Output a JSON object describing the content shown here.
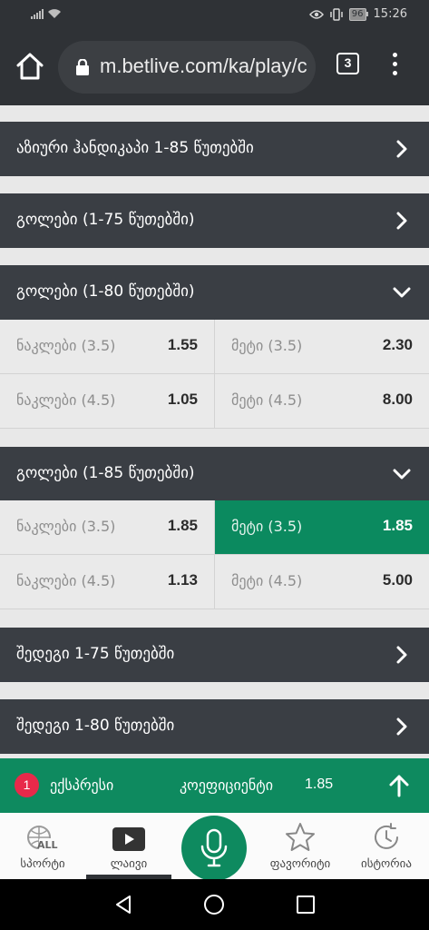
{
  "status": {
    "time": "15:26",
    "battery": "96"
  },
  "browser": {
    "url": "m.betlive.com/ka/play/c",
    "tab_count": "3"
  },
  "sections": [
    {
      "title": "აზიური ჰანდიკაპი 1-85 წუთებში",
      "expanded": false
    },
    {
      "title": "გოლები (1-75 წუთებში)",
      "expanded": false
    },
    {
      "title": "გოლები (1-80 წუთებში)",
      "expanded": true,
      "rows": [
        {
          "under_label": "ნაკლები (3.5)",
          "under_odd": "1.55",
          "over_label": "მეტი (3.5)",
          "over_odd": "2.30"
        },
        {
          "under_label": "ნაკლები (4.5)",
          "under_odd": "1.05",
          "over_label": "მეტი (4.5)",
          "over_odd": "8.00"
        }
      ]
    },
    {
      "title": "გოლები (1-85 წუთებში)",
      "expanded": true,
      "rows": [
        {
          "under_label": "ნაკლები (3.5)",
          "under_odd": "1.85",
          "over_label": "მეტი (3.5)",
          "over_odd": "1.85",
          "over_selected": true
        },
        {
          "under_label": "ნაკლები (4.5)",
          "under_odd": "1.13",
          "over_label": "მეტი (4.5)",
          "over_odd": "5.00"
        }
      ]
    },
    {
      "title": "შედეგი 1-75 წუთებში",
      "expanded": false
    },
    {
      "title": "შედეგი 1-80 წუთებში",
      "expanded": false
    }
  ],
  "betslip": {
    "count": "1",
    "type_label": "ექსპრესი",
    "coef_label": "კოეფიციენტი",
    "coef_value": "1.85"
  },
  "bottom_nav": {
    "sports": "სპორტი",
    "sports_badge": "ALL",
    "live": "ლაივი",
    "favorites": "ფავორიტი",
    "history": "ისტორია"
  },
  "colors": {
    "accent": "#0e8a5f",
    "header": "#3a3e44",
    "badge": "#e8294a"
  }
}
